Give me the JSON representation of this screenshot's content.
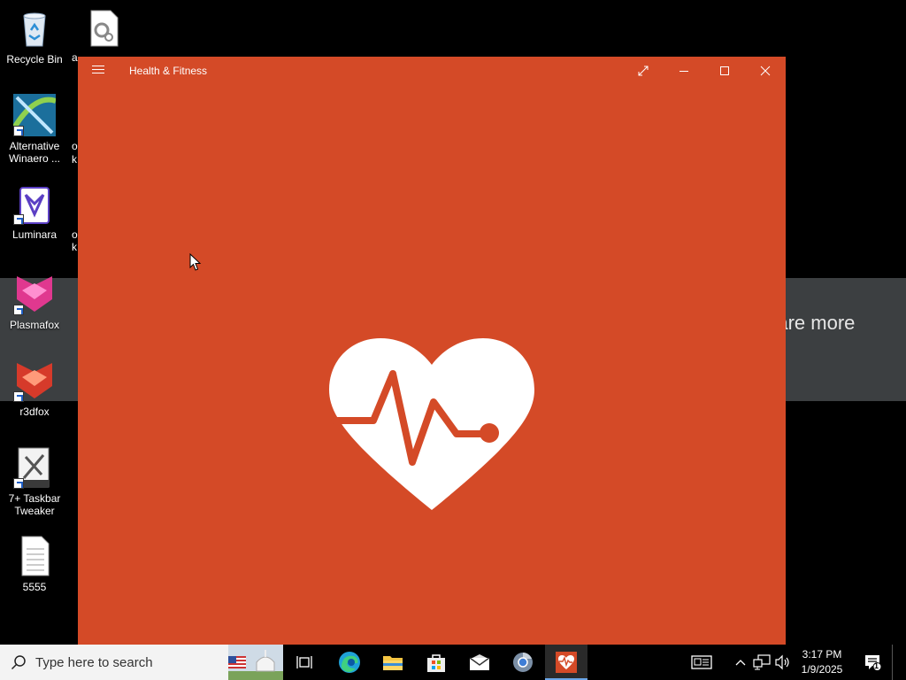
{
  "desktop": {
    "icons": [
      {
        "label": "Recycle Bin"
      },
      {
        "label": "Alternative Winaero ..."
      },
      {
        "label": "Luminara"
      },
      {
        "label": "Plasmafox"
      },
      {
        "label": "r3dfox"
      },
      {
        "label": "7+ Taskbar Tweaker"
      },
      {
        "label": "5555"
      }
    ],
    "partial_labels": [
      "a",
      "o",
      "k",
      "o",
      "k"
    ],
    "background_text": "h are more"
  },
  "app": {
    "title": "Health & Fitness",
    "accent_color": "#d44a27",
    "controls": [
      "fullscreen-icon",
      "minimize-icon",
      "maximize-icon",
      "close-icon"
    ],
    "splash_icon": "heart-pulse-icon"
  },
  "taskbar": {
    "search_placeholder": "Type here to search",
    "apps": [
      "task-view-icon",
      "edge-icon",
      "file-explorer-icon",
      "store-icon",
      "mail-icon",
      "chromium-icon",
      "health-fitness-icon"
    ],
    "active_app": "health-fitness-icon",
    "clock": {
      "time": "3:17 PM",
      "date": "1/9/2025"
    },
    "notifications_count": "1"
  }
}
